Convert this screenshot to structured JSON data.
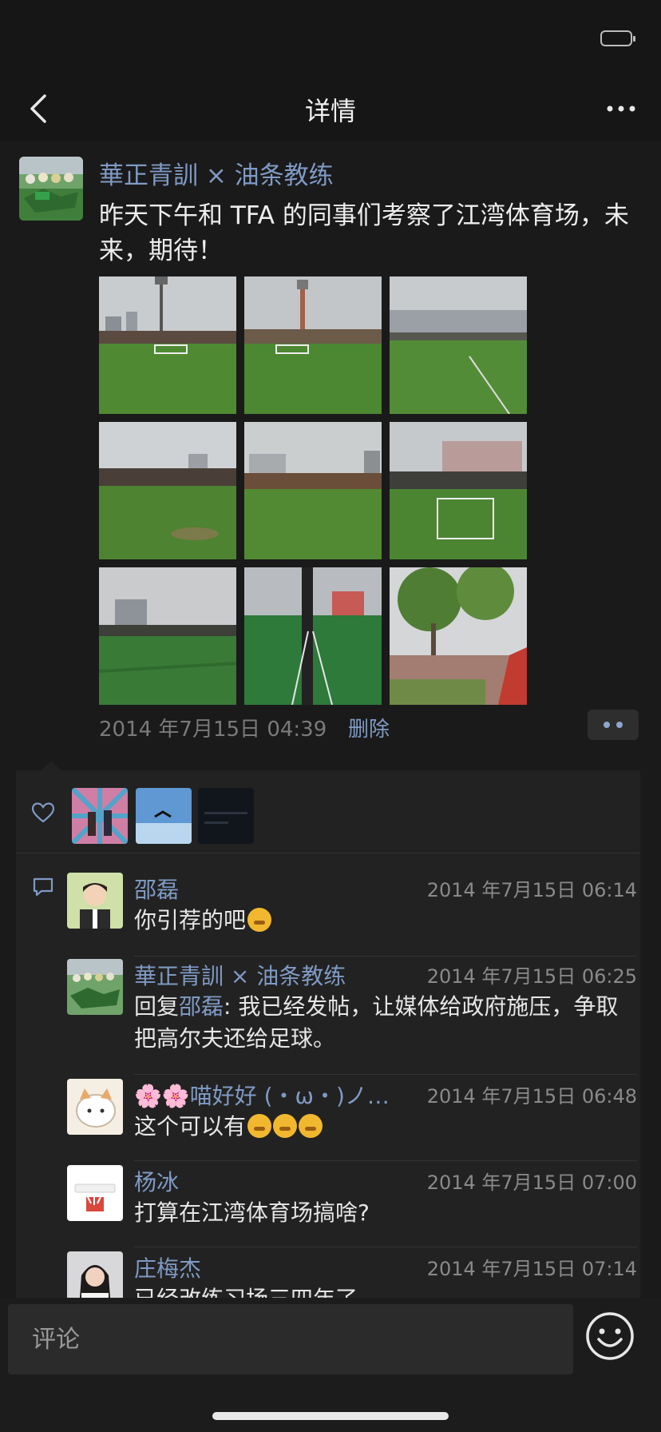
{
  "nav": {
    "title": "详情"
  },
  "post": {
    "author": "華正青訓 × 油条教练",
    "text": "昨天下午和 TFA 的同事们考察了江湾体育场，未来，期待！",
    "time": "2014 年7月15日 04:39",
    "delete_label": "删除"
  },
  "likes": {
    "count_shown": 3
  },
  "comments": [
    {
      "name": "邵磊",
      "time": "2014 年7月15日 06:14",
      "text": "你引荐的吧"
    },
    {
      "name": "華正青訓 × 油条教练",
      "time": "2014 年7月15日 06:25",
      "reply_prefix": "回复",
      "reply_to": "邵磊",
      "text": ": 我已经发帖，让媒体给政府施压，争取把高尔夫还给足球。"
    },
    {
      "name": "🌸🌸喵好好 (・ω・)ノ…",
      "time": "2014 年7月15日 06:48",
      "text": "这个可以有"
    },
    {
      "name": "杨冰",
      "time": "2014 年7月15日 07:00",
      "text": "打算在江湾体育场搞啥?"
    },
    {
      "name": "庄梅杰",
      "time": "2014 年7月15日 07:14",
      "text": "已经改练习场三四年了"
    }
  ],
  "composer": {
    "placeholder": "评论"
  },
  "colors": {
    "link": "#7f9ac4",
    "background": "#1a1a1a"
  }
}
